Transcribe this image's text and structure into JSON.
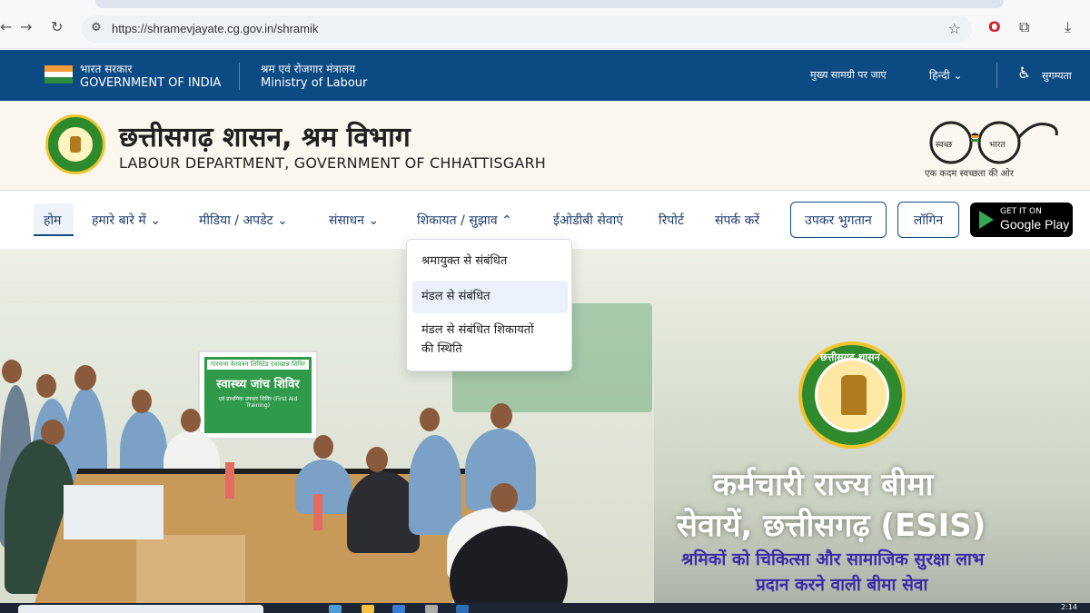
{
  "browser": {
    "url": "https://shramevjayate.cg.gov.in/shramik",
    "icons": [
      "back-arrow-icon",
      "forward-arrow-icon",
      "reload-icon",
      "site-info-icon",
      "star-icon",
      "opera-icon",
      "extensions-icon",
      "download-icon"
    ]
  },
  "gov_strip": {
    "gov_hi": "भारत सरकार",
    "gov_en": "GOVERNMENT OF INDIA",
    "ministry_hi": "श्रम एवं रोजगार मंत्रालय",
    "ministry_en": "Ministry of Labour",
    "skip_label": "मुख्य सामग्री पर जाएं",
    "language_label": "हिन्दी",
    "accessibility_label": "सुगम्यता",
    "colors": {
      "background": "#0c4a84"
    }
  },
  "header": {
    "title_hi": "छत्तीसगढ़ शासन, श्रम विभाग",
    "title_en": "LABOUR DEPARTMENT, GOVERNMENT OF CHHATTISGARH",
    "swachh_left": "स्वच्छ",
    "swachh_right": "भारत",
    "swachh_tagline": "एक कदम स्वच्छता की ओर"
  },
  "nav": {
    "items": [
      {
        "label": "होम",
        "has_dropdown": false
      },
      {
        "label": "हमारे बारे में",
        "has_dropdown": true
      },
      {
        "label": "मीडिया / अपडेट",
        "has_dropdown": true
      },
      {
        "label": "संसाधन",
        "has_dropdown": true
      },
      {
        "label": "शिकायत / सुझाव",
        "has_dropdown": true,
        "open": true
      },
      {
        "label": "ईओडीबी सेवाएं",
        "has_dropdown": false
      },
      {
        "label": "रिपोर्ट",
        "has_dropdown": false
      },
      {
        "label": "संपर्क करें",
        "has_dropdown": false
      }
    ],
    "cess_button": "उपकर भुगतान",
    "login_button": "लॉगिन",
    "play_small": "GET IT ON",
    "play_big": "Google Play"
  },
  "dropdown": {
    "items": [
      {
        "label": "श्रमायुक्त से संबंधित"
      },
      {
        "label": "मंडल से संबंधित",
        "highlighted": true
      },
      {
        "label": "मंडल से संबंधित शिकायतों",
        "label_line2": "की स्थिति"
      }
    ]
  },
  "hero": {
    "banner_top": "गारवन्स केरवत्रन लिमिटेड दवाखान्न शिविर",
    "banner_title": "स्वास्थ्य जांच शिविर",
    "banner_sub": "एवं प्राथमिक उपचार शिविर (First Aid Training)",
    "emblem_text": "छत्तीसगढ़ शासन",
    "line1": "कर्मचारी राज्य बीमा",
    "line2": "सेवायें, छत्तीसगढ़ (ESIS)",
    "line3": "श्रमिकों को चिकित्सा और सामाजिक सुरक्षा लाभ",
    "line4": "प्रदान करने वाली बीमा सेवा"
  },
  "taskbar": {
    "clock": "2:14"
  }
}
